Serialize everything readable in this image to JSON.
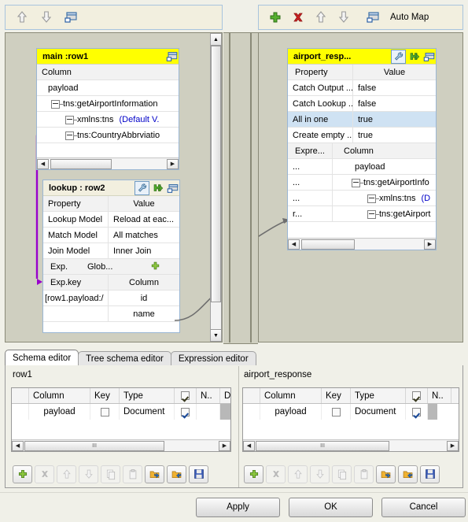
{
  "left_toolbar": {
    "buttons": [
      {
        "name": "move-up-icon",
        "label": "Move up"
      },
      {
        "name": "move-down-icon",
        "label": "Move down"
      },
      {
        "name": "window-icon",
        "label": "Minimize/Maximize"
      }
    ]
  },
  "right_toolbar": {
    "buttons": [
      {
        "name": "add-icon",
        "label": "Add"
      },
      {
        "name": "delete-icon",
        "label": "Delete"
      },
      {
        "name": "move-up-icon",
        "label": "Move up"
      },
      {
        "name": "move-down-icon",
        "label": "Move down"
      },
      {
        "name": "auto-map-icon",
        "label": "Auto Map"
      }
    ],
    "auto_map_label": "Auto Map"
  },
  "main_table": {
    "title": "main :row1",
    "header": "Column",
    "rows": [
      {
        "indent": 0,
        "expander": false,
        "text": "payload",
        "suffix": ""
      },
      {
        "indent": 1,
        "expander": true,
        "text": "tns:getAirportInformation",
        "suffix": ""
      },
      {
        "indent": 2,
        "expander": true,
        "text": "xmlns:tns",
        "suffix": "(Default V."
      },
      {
        "indent": 2,
        "expander": true,
        "text": "tns:CountryAbbrviatio",
        "suffix": ""
      }
    ]
  },
  "lookup_table": {
    "title": "lookup : row2",
    "prop_header": "Property",
    "value_header": "Value",
    "properties": [
      {
        "name": "Lookup Model",
        "value": "Reload at eac..."
      },
      {
        "name": "Match Model",
        "value": "All matches"
      },
      {
        "name": "Join Model",
        "value": "Inner Join"
      }
    ],
    "exp_label": "Exp.",
    "glob_label": "Glob...",
    "expkey_header": "Exp.key",
    "column_header": "Column",
    "key_rows": [
      {
        "key": "[row1.payload:/",
        "column": "id"
      },
      {
        "key": "",
        "column": "name"
      }
    ]
  },
  "response_table": {
    "title": "airport_resp...",
    "prop_header": "Property",
    "value_header": "Value",
    "properties": [
      {
        "name": "Catch Output ...",
        "value": "false",
        "selected": false
      },
      {
        "name": "Catch Lookup ...",
        "value": "false",
        "selected": false
      },
      {
        "name": "All in one",
        "value": "true",
        "selected": true
      },
      {
        "name": "Create empty ...",
        "value": "true",
        "selected": false
      }
    ],
    "expr_header": "Expre...",
    "column_header": "Column",
    "mapping_rows": [
      {
        "expr": "...",
        "indent": 0,
        "expander": false,
        "text": "payload",
        "suffix": ""
      },
      {
        "expr": "...",
        "indent": 1,
        "expander": true,
        "text": "tns:getAirportInfo",
        "suffix": ""
      },
      {
        "expr": "...",
        "indent": 2,
        "expander": true,
        "text": "xmlns:tns",
        "suffix": "(D"
      },
      {
        "expr": "r...",
        "indent": 2,
        "expander": true,
        "text": "tns:getAirport",
        "suffix": ""
      }
    ]
  },
  "tabs": [
    {
      "label": "Schema editor",
      "active": true
    },
    {
      "label": "Tree schema editor",
      "active": false
    },
    {
      "label": "Expression editor",
      "active": false
    }
  ],
  "schema_left": {
    "title": "row1",
    "columns": [
      "",
      "Column",
      "Key",
      "Type",
      "",
      "N..",
      "D."
    ],
    "check_header_col": 4,
    "rows": [
      {
        "col": "payload",
        "key": false,
        "type": "Document",
        "nullable": true
      }
    ]
  },
  "schema_right": {
    "title": "airport_response",
    "columns": [
      "",
      "Column",
      "Key",
      "Type",
      "",
      "N..",
      ""
    ],
    "check_header_col": 4,
    "rows": [
      {
        "col": "payload",
        "key": false,
        "type": "Document",
        "nullable": true
      }
    ]
  },
  "schema_actions": [
    {
      "name": "add-button",
      "label": "Add",
      "enabled": true
    },
    {
      "name": "delete-button",
      "label": "Delete",
      "enabled": false
    },
    {
      "name": "move-up-button",
      "label": "Move up",
      "enabled": false
    },
    {
      "name": "move-down-button",
      "label": "Move down",
      "enabled": false
    },
    {
      "name": "copy-button",
      "label": "Copy",
      "enabled": false
    },
    {
      "name": "paste-button",
      "label": "Paste",
      "enabled": false
    },
    {
      "name": "import-schema-button",
      "label": "Import schema",
      "enabled": true
    },
    {
      "name": "export-schema-button",
      "label": "Export schema",
      "enabled": true
    },
    {
      "name": "save-schema-button",
      "label": "Save schema",
      "enabled": true
    }
  ],
  "dialog_buttons": [
    {
      "name": "apply-button",
      "label": "Apply"
    },
    {
      "name": "ok-button",
      "label": "OK"
    },
    {
      "name": "cancel-button",
      "label": "Cancel"
    }
  ],
  "colors": {
    "title_yellow": "#ffff00",
    "selection_blue": "#cfe2f3",
    "canvas": "#cfcfc0",
    "toolbar": "#f2efdf",
    "link_purple": "#9900cc",
    "link_gray": "#6e6e6e"
  }
}
